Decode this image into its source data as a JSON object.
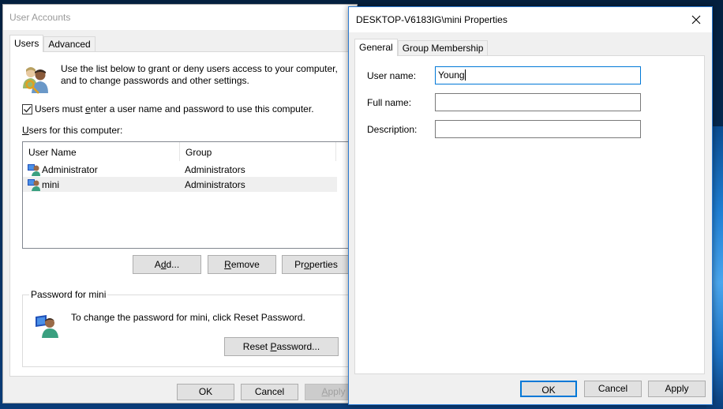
{
  "user_accounts": {
    "title": "User Accounts",
    "tabs": [
      {
        "label": "Users",
        "active": true
      },
      {
        "label": "Advanced",
        "active": false
      }
    ],
    "intro_text_line1": "Use the list below to grant or deny users access to your computer,",
    "intro_text_line2": "and to change passwords and other settings.",
    "require_login_checkbox": {
      "checked": true,
      "label_pre": "Users must ",
      "label_accel": "e",
      "label_post": "nter a user name and password to use this computer."
    },
    "users_label_accel": "U",
    "users_label_rest": "sers for this computer:",
    "list": {
      "columns": [
        "User Name",
        "Group"
      ],
      "rows": [
        {
          "name": "Administrator",
          "group": "Administrators",
          "selected": false
        },
        {
          "name": "mini",
          "group": "Administrators",
          "selected": true
        }
      ]
    },
    "buttons": {
      "add": {
        "pre": "A",
        "accel": "d",
        "post": "d..."
      },
      "remove": {
        "pre": "",
        "accel": "R",
        "post": "emove"
      },
      "properties": {
        "pre": "Pr",
        "accel": "o",
        "post": "perties"
      }
    },
    "password_group": {
      "legend": "Password for mini",
      "text": "To change the password for mini, click Reset Password.",
      "reset_button": {
        "pre": "Reset ",
        "accel": "P",
        "post": "assword..."
      }
    },
    "footer": {
      "ok": "OK",
      "cancel": "Cancel",
      "apply_accel": "A",
      "apply_rest": "pply",
      "apply_enabled": false
    }
  },
  "properties_dialog": {
    "title": "DESKTOP-V6183IG\\mini Properties",
    "tabs": [
      {
        "label": "General",
        "active": true
      },
      {
        "label": "Group Membership",
        "active": false
      }
    ],
    "fields": {
      "user_name": {
        "label": "User name:",
        "value": "Young"
      },
      "full_name": {
        "label": "Full name:",
        "value": ""
      },
      "description": {
        "label": "Description:",
        "value": ""
      }
    },
    "footer": {
      "ok": "OK",
      "cancel": "Cancel",
      "apply": "Apply"
    }
  },
  "colors": {
    "accent": "#0078d7",
    "window_bg": "#f0f0f0",
    "selection_bg": "#efefef"
  }
}
